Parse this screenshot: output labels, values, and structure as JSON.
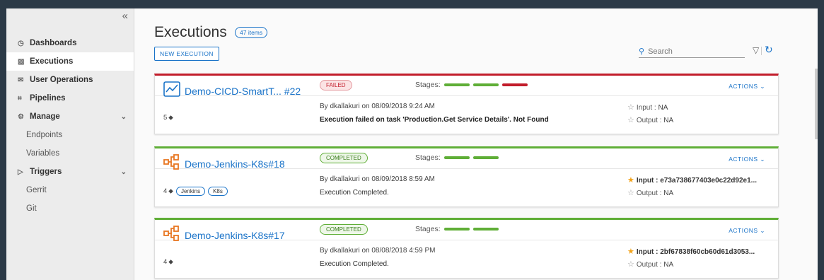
{
  "sidebar": {
    "collapse_icon": "«",
    "items": [
      {
        "label": "Dashboards",
        "icon": "gauge-icon",
        "glyph": "◷",
        "bold": true
      },
      {
        "label": "Executions",
        "icon": "chart-icon",
        "glyph": "▨",
        "bold": true,
        "active": true
      },
      {
        "label": "User Operations",
        "icon": "envelope-icon",
        "glyph": "✉",
        "bold": true
      },
      {
        "label": "Pipelines",
        "icon": "pipeline-icon",
        "glyph": "⌗",
        "bold": true
      },
      {
        "label": "Manage",
        "icon": "gear-icon",
        "glyph": "⚙",
        "bold": true,
        "expandable": true
      },
      {
        "label": "Endpoints",
        "sub": true
      },
      {
        "label": "Variables",
        "sub": true
      },
      {
        "label": "Triggers",
        "icon": "trigger-icon",
        "glyph": "▷",
        "bold": true,
        "expandable": true
      },
      {
        "label": "Gerrit",
        "sub": true
      },
      {
        "label": "Git",
        "sub": true
      }
    ]
  },
  "header": {
    "title": "Executions",
    "count": "47 items",
    "new_button": "NEW EXECUTION",
    "search_placeholder": "Search"
  },
  "colors": {
    "accent": "#1a73c8",
    "failed": "#c21d2b",
    "success": "#5fae37",
    "star": "#f2a31b"
  },
  "cards": [
    {
      "status": "failed",
      "name": "Demo-CICD-SmartT... #22",
      "icon": "chart-window-icon",
      "tag_count": "5",
      "tags": [],
      "badge": "FAILED",
      "stages_label": "Stages:",
      "stages": [
        "ok",
        "ok",
        "bad"
      ],
      "actions": "ACTIONS ⌄",
      "byline": "By dkallakuri on 08/09/2018 9:24 AM",
      "message": "Execution failed on task 'Production.Get Service Details'. Not Found",
      "message_bold": true,
      "input_label": "Input :",
      "input_value": "NA",
      "input_filled": false,
      "output_label": "Output :",
      "output_value": "NA"
    },
    {
      "status": "completed",
      "name": "Demo-Jenkins-K8s#18",
      "icon": "pipeline-nodes-icon",
      "tag_count": "4",
      "tags": [
        "Jenkins",
        "K8s"
      ],
      "badge": "COMPLETED",
      "stages_label": "Stages:",
      "stages": [
        "ok",
        "ok"
      ],
      "actions": "ACTIONS ⌄",
      "byline": "By dkallakuri on 08/09/2018 8:59 AM",
      "message": "Execution Completed.",
      "message_bold": false,
      "input_label": "Input :",
      "input_value": "e73a738677403e0c22d92e1...",
      "input_filled": true,
      "output_label": "Output :",
      "output_value": "NA"
    },
    {
      "status": "completed",
      "name": "Demo-Jenkins-K8s#17",
      "icon": "pipeline-nodes-icon",
      "tag_count": "4",
      "tags": [],
      "badge": "COMPLETED",
      "stages_label": "Stages:",
      "stages": [
        "ok",
        "ok"
      ],
      "actions": "ACTIONS ⌄",
      "byline": "By dkallakuri on 08/08/2018 4:59 PM",
      "message": "Execution Completed.",
      "message_bold": false,
      "input_label": "Input :",
      "input_value": "2bf67838f60cb60d61d3053...",
      "input_filled": true,
      "output_label": "Output :",
      "output_value": "NA"
    }
  ]
}
